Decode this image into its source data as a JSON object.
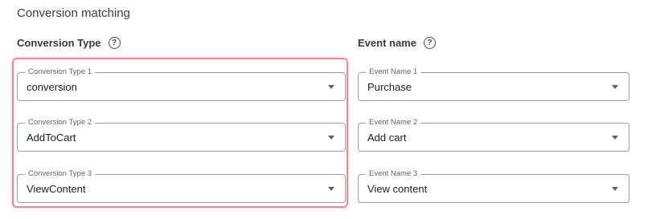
{
  "section_title": "Conversion matching",
  "columns": {
    "conversion_type": {
      "header": "Conversion Type"
    },
    "event_name": {
      "header": "Event name"
    }
  },
  "help_icon_glyph": "?",
  "conversion_types": [
    {
      "label": "Conversion Type 1",
      "value": "conversion"
    },
    {
      "label": "Conversion Type 2",
      "value": "AddToCart"
    },
    {
      "label": "Conversion Type 3",
      "value": "ViewContent"
    }
  ],
  "event_names": [
    {
      "label": "Event Name 1",
      "value": "Purchase"
    },
    {
      "label": "Event Name 2",
      "value": "Add cart"
    },
    {
      "label": "Event Name 3",
      "value": "View content"
    }
  ],
  "colors": {
    "highlight_border": "#ef8a8a",
    "field_border": "#9e9e9e"
  }
}
